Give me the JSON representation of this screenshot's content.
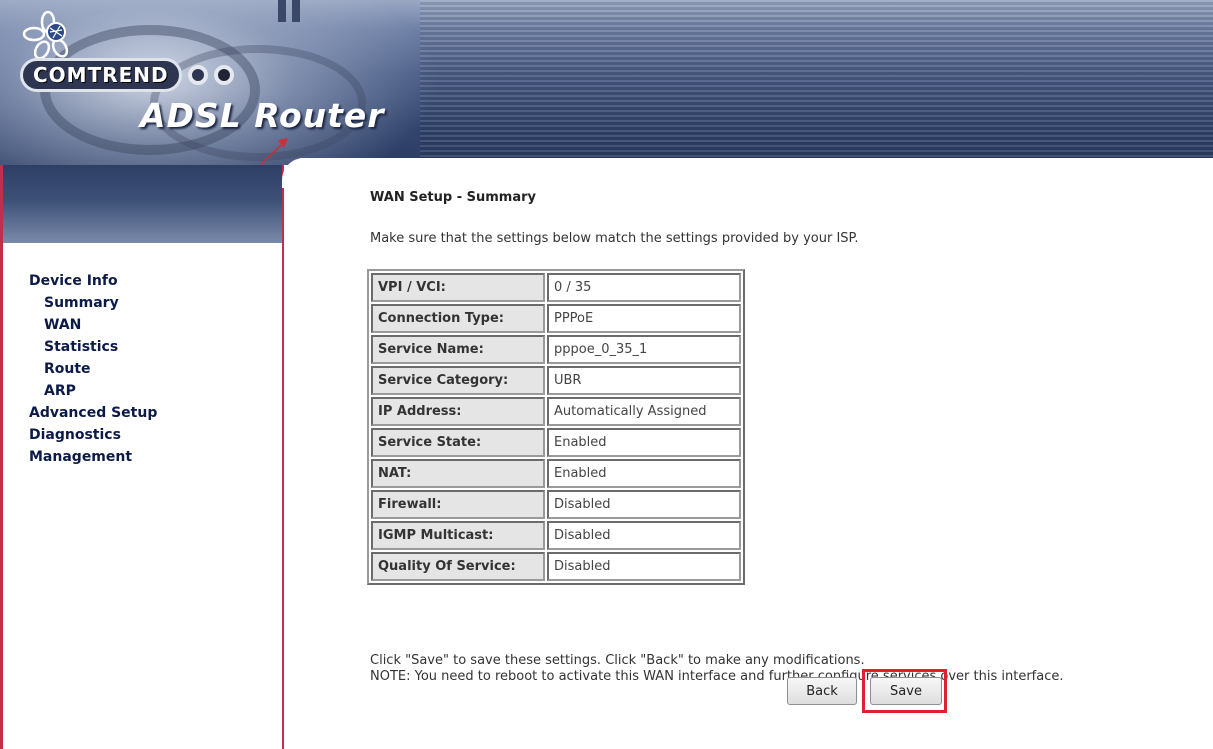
{
  "brand": {
    "logo_text": "COMTREND",
    "product_title": "ADSL Router"
  },
  "sidebar": {
    "items": [
      {
        "label": "Device Info",
        "level": "top"
      },
      {
        "label": "Summary",
        "level": "sub"
      },
      {
        "label": "WAN",
        "level": "sub"
      },
      {
        "label": "Statistics",
        "level": "sub"
      },
      {
        "label": "Route",
        "level": "sub"
      },
      {
        "label": "ARP",
        "level": "sub"
      },
      {
        "label": "Advanced Setup",
        "level": "top"
      },
      {
        "label": "Diagnostics",
        "level": "top"
      },
      {
        "label": "Management",
        "level": "top"
      }
    ]
  },
  "main": {
    "title": "WAN Setup - Summary",
    "instructions": "Make sure that the settings below match the settings provided by your ISP.",
    "rows": [
      {
        "key": "VPI / VCI:",
        "value": "0 / 35"
      },
      {
        "key": "Connection Type:",
        "value": "PPPoE"
      },
      {
        "key": "Service Name:",
        "value": "pppoe_0_35_1"
      },
      {
        "key": "Service Category:",
        "value": "UBR"
      },
      {
        "key": "IP Address:",
        "value": "Automatically Assigned"
      },
      {
        "key": "Service State:",
        "value": "Enabled"
      },
      {
        "key": "NAT:",
        "value": "Enabled"
      },
      {
        "key": "Firewall:",
        "value": "Disabled"
      },
      {
        "key": "IGMP Multicast:",
        "value": "Disabled"
      },
      {
        "key": "Quality Of Service:",
        "value": "Disabled"
      }
    ],
    "footnote_line1": "Click \"Save\" to save these settings. Click \"Back\" to make any modifications.",
    "footnote_line2": "NOTE: You need to reboot to activate this WAN interface and further configure services over this interface.",
    "back_label": "Back",
    "save_label": "Save"
  },
  "colors": {
    "nav_text": "#0c1a49",
    "highlight": "#e0202a",
    "sidebar_border": "#c0304a",
    "key_cell_bg": "#e5e5e5"
  }
}
